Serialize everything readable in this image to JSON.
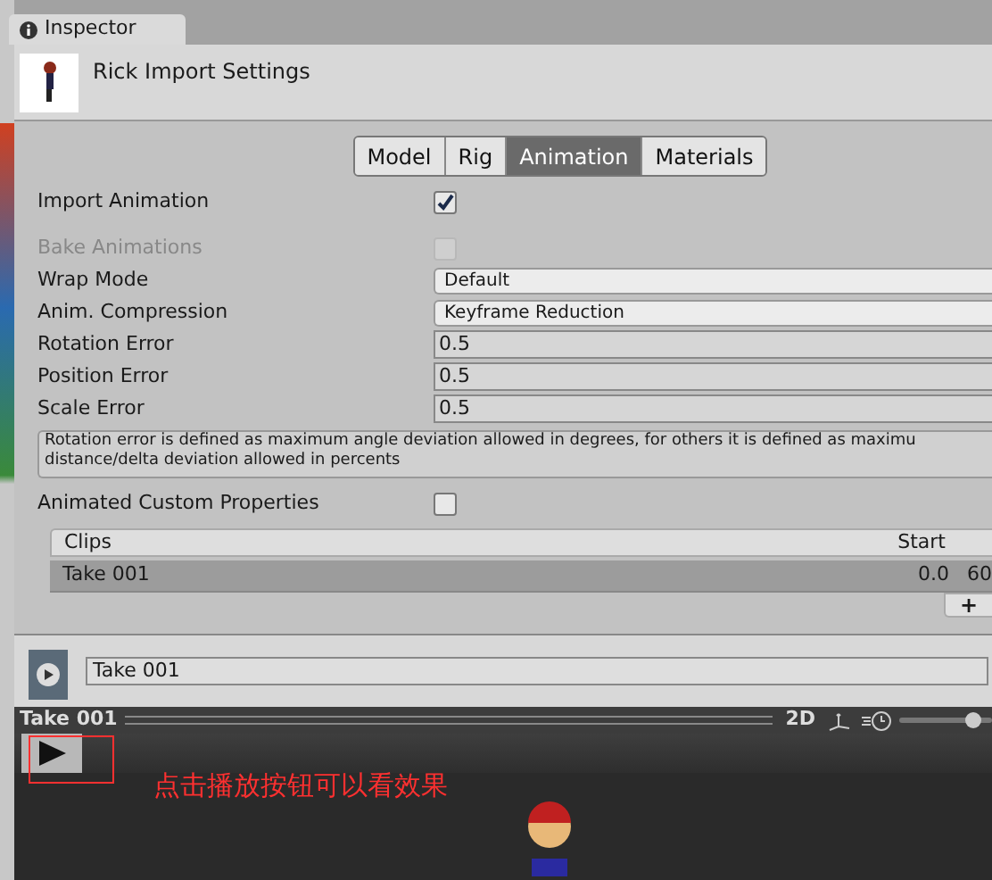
{
  "window": {
    "tab": "Inspector"
  },
  "header": {
    "title": "Rick Import Settings"
  },
  "tabs": [
    {
      "label": "Model",
      "selected": false
    },
    {
      "label": "Rig",
      "selected": false
    },
    {
      "label": "Animation",
      "selected": true
    },
    {
      "label": "Materials",
      "selected": false
    }
  ],
  "fields": [
    {
      "kind": "checkbox",
      "label": "Import Animation",
      "checked": true,
      "disabled": false
    },
    {
      "kind": "checkbox",
      "label": "Bake Animations",
      "checked": false,
      "disabled": true
    },
    {
      "kind": "dropdown",
      "label": "Wrap Mode",
      "value": "Default"
    },
    {
      "kind": "dropdown",
      "label": "Anim. Compression",
      "value": "Keyframe Reduction"
    },
    {
      "kind": "number",
      "label": "Rotation Error",
      "value": "0.5"
    },
    {
      "kind": "number",
      "label": "Position Error",
      "value": "0.5"
    },
    {
      "kind": "number",
      "label": "Scale Error",
      "value": "0.5"
    }
  ],
  "help": "Rotation error is defined as maximum angle deviation allowed in degrees, for others it is defined as maximu distance/delta deviation allowed in percents",
  "custom_properties": {
    "label": "Animated Custom Properties",
    "checked": false
  },
  "clips": {
    "columns": [
      "Clips",
      "Start"
    ],
    "rows": [
      {
        "name": "Take 001",
        "start": "0.0",
        "end": "60",
        "selected": true
      }
    ],
    "add": "+"
  },
  "clip_name": "Take 001",
  "preview": {
    "title": "Take 001",
    "mode": "2D",
    "speed": {
      "level": 0.85
    },
    "annotation": "点击播放按钮可以看效果"
  }
}
